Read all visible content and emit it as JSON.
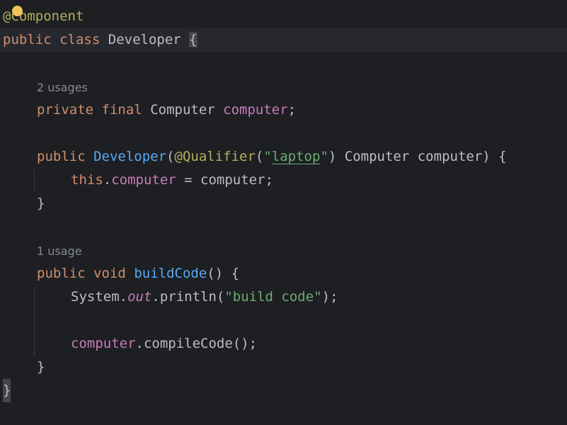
{
  "editor": {
    "lines": {
      "annotation": "@Component",
      "class_decl": {
        "kw_public": "public",
        "kw_class": "class",
        "name": "Developer",
        "open_brace": "{"
      },
      "hint_field": "2 usages",
      "field_decl": {
        "kw_private": "private",
        "kw_final": "final",
        "type": "Computer",
        "name": "computer",
        "end": ";"
      },
      "ctor_decl": {
        "kw_public": "public",
        "name": "Developer",
        "open_paren": "(",
        "annotation": "@Qualifier",
        "ann_open": "(",
        "q_open": "\"",
        "qualifier_value": "laptop",
        "q_close": "\"",
        "ann_close": ")",
        "param": "Computer computer) {"
      },
      "ctor_body": {
        "kw_this": "this",
        "dot": ".",
        "field": "computer",
        "rest": " = computer;"
      },
      "ctor_close": "}",
      "hint_method": "1 usage",
      "method_decl": {
        "kw_public": "public",
        "kw_void": "void",
        "name": "buildCode",
        "rest": "() {"
      },
      "println": {
        "cls": "System.",
        "static_field": "out",
        "call": ".println(",
        "string": "\"build code\"",
        "end": ");"
      },
      "compile": {
        "field": "computer",
        "call": ".compileCode();"
      },
      "method_close": "}",
      "class_close": "}"
    }
  },
  "colors": {
    "background": "#1e1f22",
    "current_line": "#26282e",
    "keyword": "#cf8e6d",
    "annotation": "#b3ae60",
    "field": "#c77dbb",
    "method": "#56a8f5",
    "string": "#6aab73",
    "text": "#bcbec4",
    "hint": "#868a91",
    "bulb": "#f2c55c"
  },
  "icons": {
    "intention_bulb": "lightbulb-icon"
  }
}
